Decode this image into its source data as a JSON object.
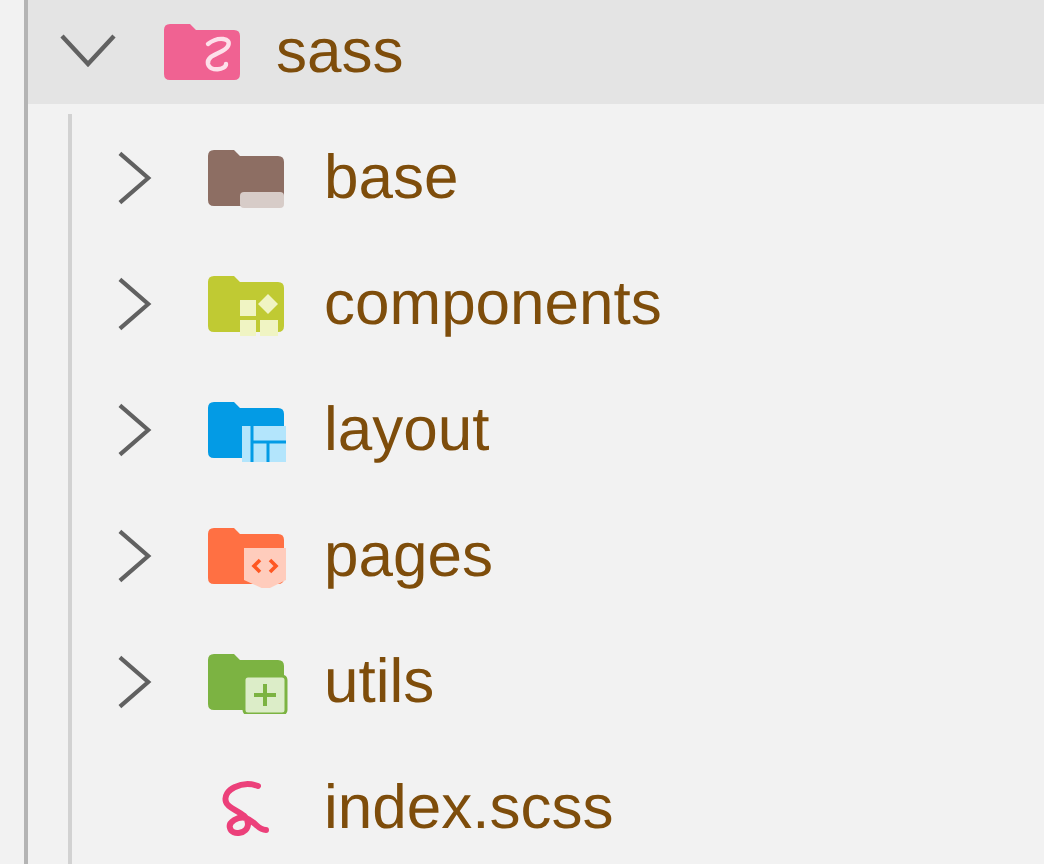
{
  "tree": {
    "name": "sass",
    "kind": "sass-folder",
    "expanded": true,
    "selected": true,
    "children": [
      {
        "name": "base",
        "kind": "base-folder",
        "expanded": false,
        "selected": false
      },
      {
        "name": "components",
        "kind": "components-folder",
        "expanded": false,
        "selected": false
      },
      {
        "name": "layout",
        "kind": "layout-folder",
        "expanded": false,
        "selected": false
      },
      {
        "name": "pages",
        "kind": "pages-folder",
        "expanded": false,
        "selected": false
      },
      {
        "name": "utils",
        "kind": "utils-folder",
        "expanded": false,
        "selected": false
      },
      {
        "name": "index.scss",
        "kind": "sass-file",
        "selected": false
      }
    ]
  }
}
